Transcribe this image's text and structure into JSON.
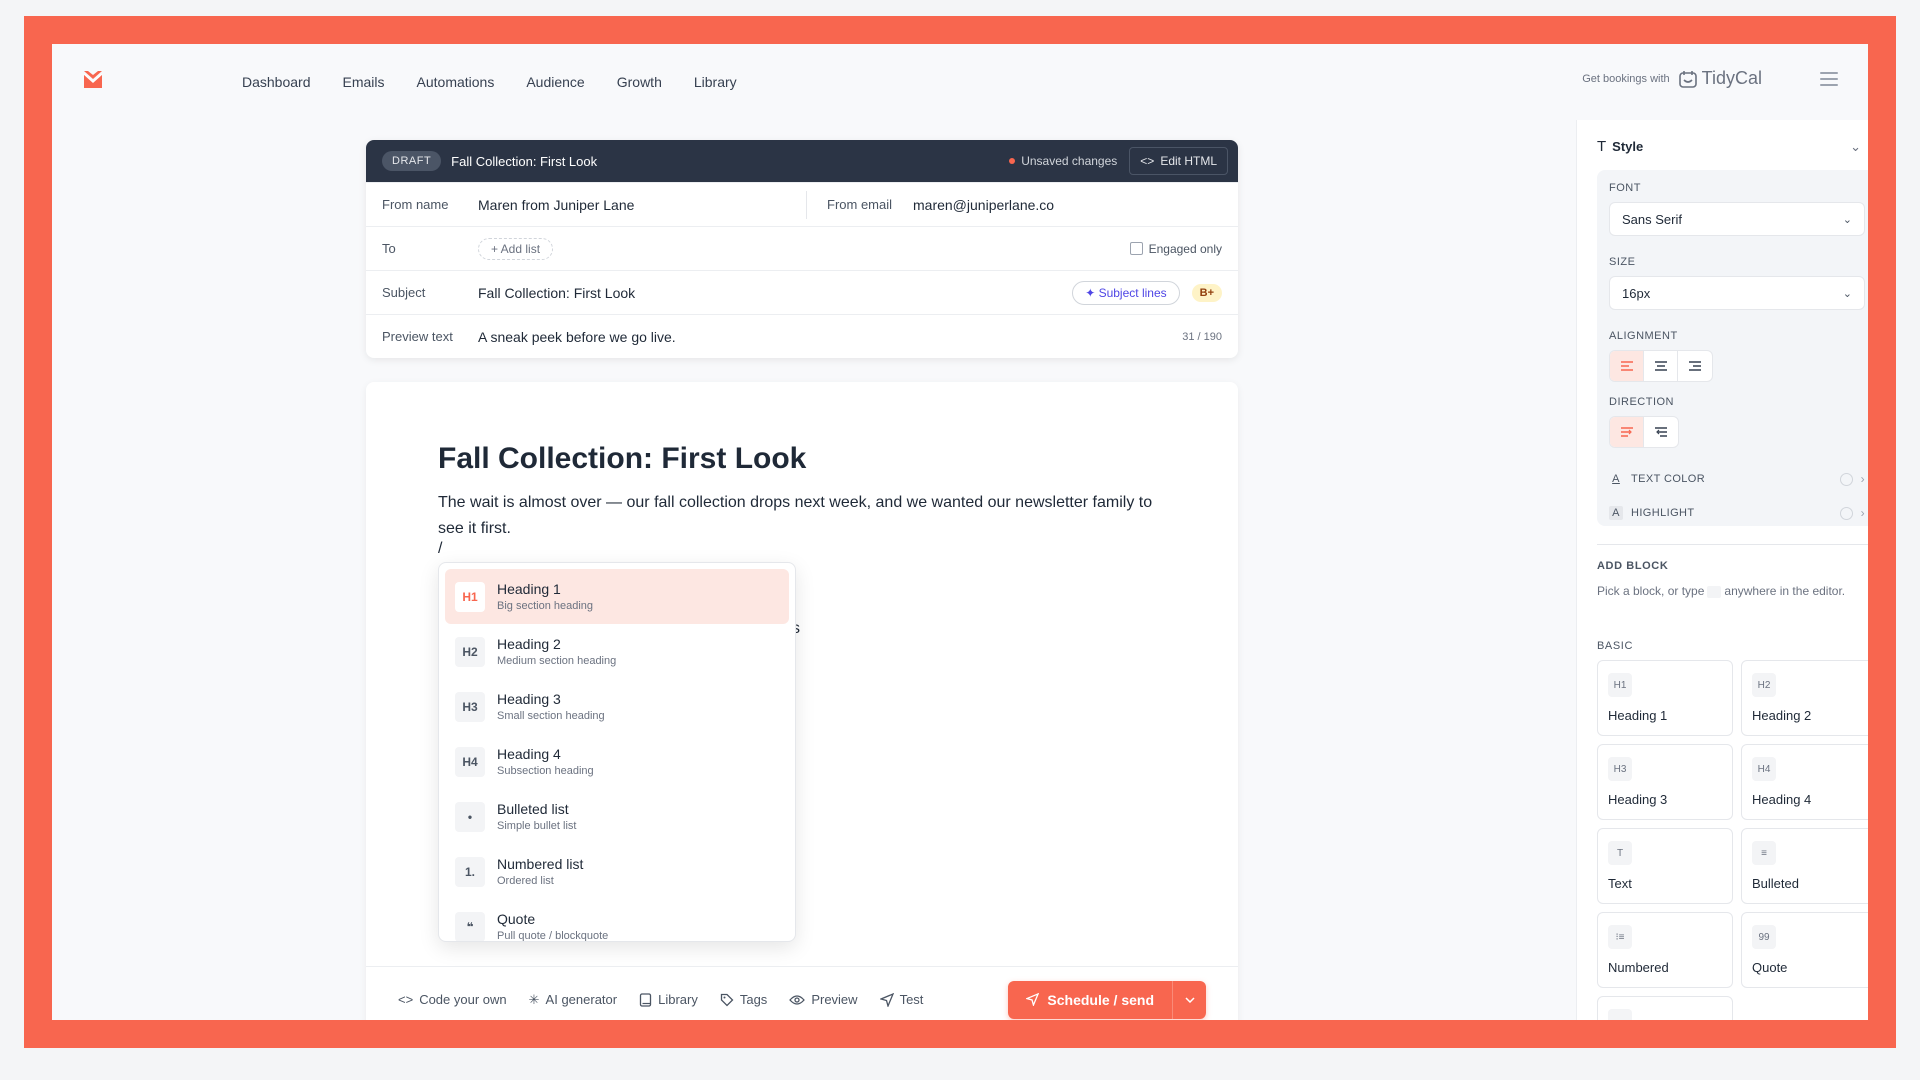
{
  "nav": {
    "links": [
      "Dashboard",
      "Emails",
      "Automations",
      "Audience",
      "Growth",
      "Library"
    ],
    "promo_small": "Get bookings with",
    "promo_brand": "TidyCal"
  },
  "header": {
    "badge": "DRAFT",
    "title": "Fall Collection: First Look",
    "unsaved": "Unsaved changes",
    "edit_html": "Edit HTML",
    "from_name_label": "From name",
    "from_name": "Maren from Juniper Lane",
    "from_email_label": "From email",
    "from_email": "maren@juniperlane.co",
    "to_label": "To",
    "add_list": "+ Add list",
    "engaged_only": "Engaged only",
    "subject_label": "Subject",
    "subject": "Fall Collection: First Look",
    "subject_lines_btn": "Subject lines",
    "grade": "B+",
    "preview_label": "Preview text",
    "preview": "A sneak peek before we go live.",
    "preview_count": "31 / 190"
  },
  "editor": {
    "title": "Fall Collection: First Look",
    "paragraph": "The wait is almost over — our fall collection drops next week, and we wanted our newsletter family to see it first.",
    "slash": "/",
    "hidden_fragment": "s",
    "menu": [
      {
        "icon": "H1",
        "title": "Heading 1",
        "desc": "Big section heading",
        "active": true
      },
      {
        "icon": "H2",
        "title": "Heading 2",
        "desc": "Medium section heading",
        "active": false
      },
      {
        "icon": "H3",
        "title": "Heading 3",
        "desc": "Small section heading",
        "active": false
      },
      {
        "icon": "H4",
        "title": "Heading 4",
        "desc": "Subsection heading",
        "active": false
      },
      {
        "icon": "•",
        "title": "Bulleted list",
        "desc": "Simple bullet list",
        "active": false
      },
      {
        "icon": "1.",
        "title": "Numbered list",
        "desc": "Ordered list",
        "active": false
      },
      {
        "icon": "❝",
        "title": "Quote",
        "desc": "Pull quote / blockquote",
        "active": false
      }
    ]
  },
  "toolbar": {
    "code": "Code your own",
    "ai": "AI generator",
    "library": "Library",
    "tags": "Tags",
    "preview": "Preview",
    "test": "Test",
    "send": "Schedule / send"
  },
  "panel": {
    "style_title": "Style",
    "font_label": "FONT",
    "font_value": "Sans Serif",
    "size_label": "SIZE",
    "size_value": "16px",
    "alignment_label": "ALIGNMENT",
    "direction_label": "DIRECTION",
    "text_color": "TEXT COLOR",
    "highlight": "HIGHLIGHT",
    "add_block": "ADD BLOCK",
    "add_block_sub_a": "Pick a block, or type",
    "add_block_sub_b": "anywhere in the editor.",
    "basic": "BASIC",
    "tiles": [
      {
        "icon": "H1",
        "label": "Heading 1"
      },
      {
        "icon": "H2",
        "label": "Heading 2"
      },
      {
        "icon": "H3",
        "label": "Heading 3"
      },
      {
        "icon": "H4",
        "label": "Heading 4"
      },
      {
        "icon": "T",
        "label": "Text"
      },
      {
        "icon": "≡",
        "label": "Bulleted"
      },
      {
        "icon": "⁝≡",
        "label": "Numbered"
      },
      {
        "icon": "99",
        "label": "Quote"
      },
      {
        "icon": "—",
        "label": ""
      }
    ]
  },
  "colors": {
    "accent": "#f8664f",
    "header_bar": "#2b3445",
    "active_bg": "#fde7e2"
  }
}
